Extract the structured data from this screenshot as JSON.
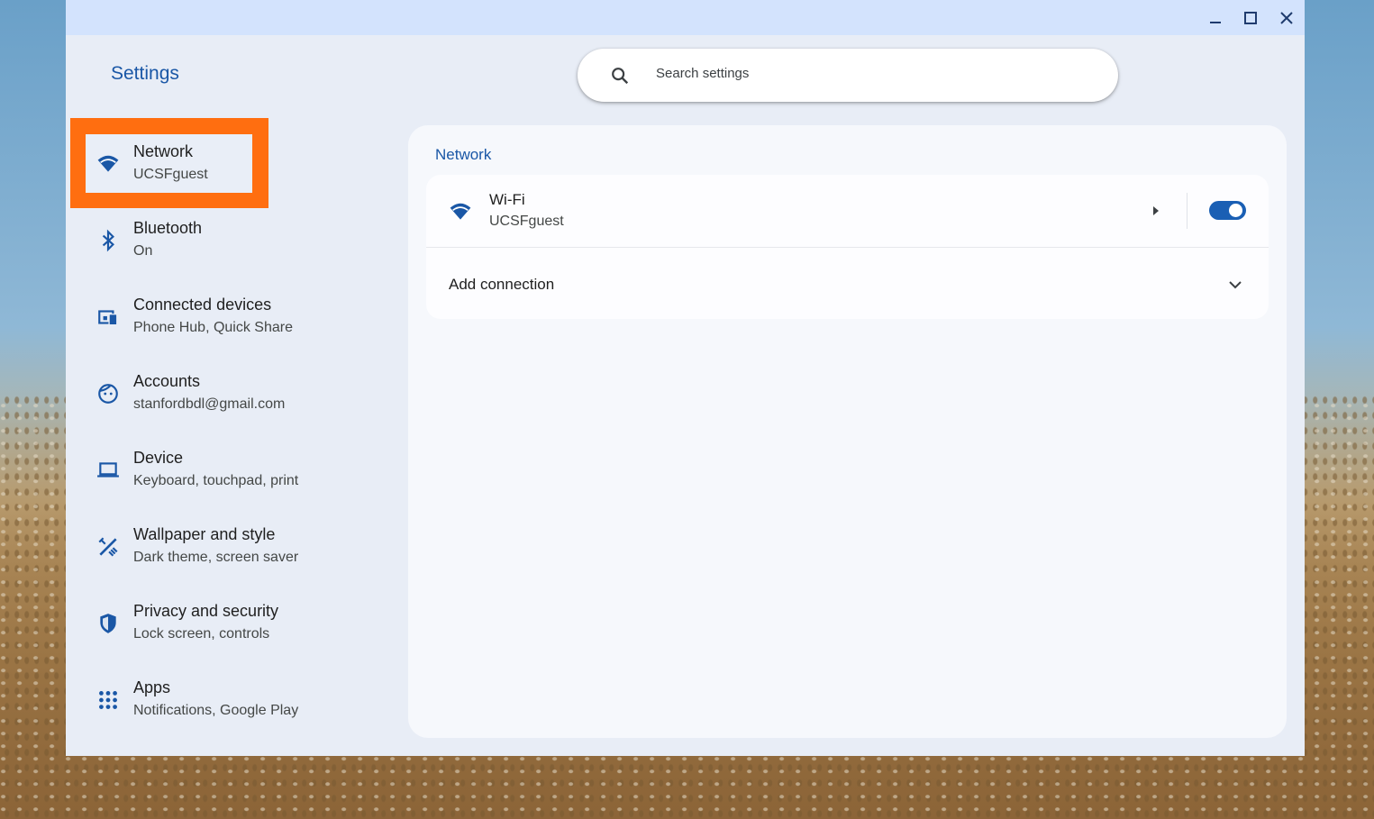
{
  "window": {
    "title": "Settings"
  },
  "search": {
    "placeholder": "Search settings"
  },
  "sidebar": {
    "items": [
      {
        "label": "Network",
        "sub": "UCSFguest"
      },
      {
        "label": "Bluetooth",
        "sub": "On"
      },
      {
        "label": "Connected devices",
        "sub": "Phone Hub, Quick Share"
      },
      {
        "label": "Accounts",
        "sub": "stanfordbdl@gmail.com"
      },
      {
        "label": "Device",
        "sub": "Keyboard, touchpad, print"
      },
      {
        "label": "Wallpaper and style",
        "sub": "Dark theme, screen saver"
      },
      {
        "label": "Privacy and security",
        "sub": "Lock screen, controls"
      },
      {
        "label": "Apps",
        "sub": "Notifications, Google Play"
      }
    ]
  },
  "main": {
    "section_title": "Network",
    "wifi": {
      "title": "Wi-Fi",
      "network": "UCSFguest",
      "enabled": true
    },
    "add_connection": "Add connection"
  },
  "colors": {
    "accent": "#1a57a6",
    "highlight": "#ff6e10",
    "toggle_on": "#1a5fb4"
  }
}
